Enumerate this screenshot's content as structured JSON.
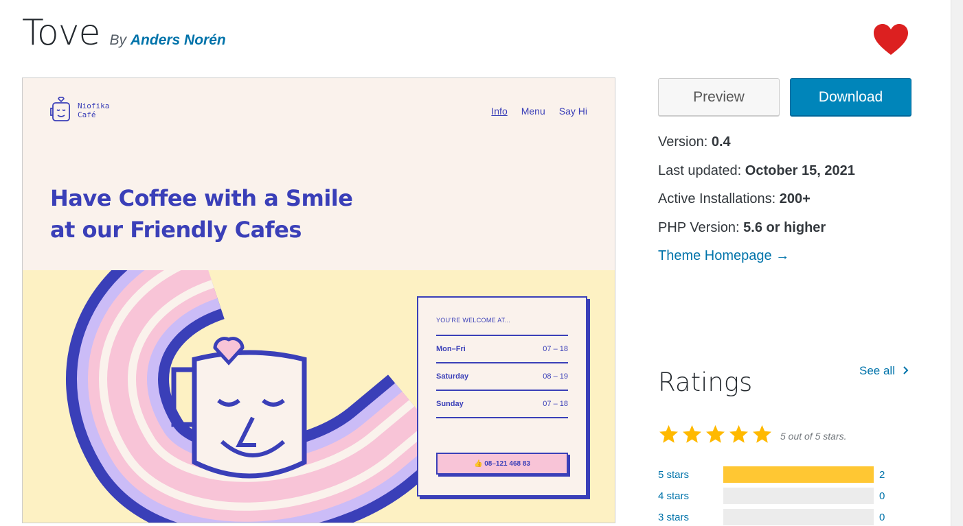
{
  "theme": {
    "title": "Tove",
    "by_prefix": "By",
    "author": "Anders Norén"
  },
  "screenshot": {
    "logo_text": "Niofika\nCafé",
    "nav": [
      "Info",
      "Menu",
      "Say Hi"
    ],
    "headline_line1": "Have Coffee with a Smile",
    "headline_line2": "at our Friendly Cafes",
    "card_title": "YOU'RE WELCOME AT...",
    "hours": [
      {
        "day": "Mon–Fri",
        "time": "07 – 18"
      },
      {
        "day": "Saturday",
        "time": "08 – 19"
      },
      {
        "day": "Sunday",
        "time": "07 – 18"
      }
    ],
    "phone": "👍 08–121 468 83"
  },
  "actions": {
    "preview_label": "Preview",
    "download_label": "Download"
  },
  "meta": {
    "version_label": "Version:",
    "version_value": "0.4",
    "updated_label": "Last updated:",
    "updated_value": "October 15, 2021",
    "installs_label": "Active Installations:",
    "installs_value": "200+",
    "php_label": "PHP Version:",
    "php_value": "5.6 or higher",
    "homepage_link": "Theme Homepage →"
  },
  "ratings": {
    "title": "Ratings",
    "see_all": "See all",
    "stars_caption": "5 out of 5 stars.",
    "stars_value": 5,
    "bars": [
      {
        "label": "5 stars",
        "count": "2",
        "fraction": 1.0
      },
      {
        "label": "4 stars",
        "count": "0",
        "fraction": 0
      },
      {
        "label": "3 stars",
        "count": "0",
        "fraction": 0
      }
    ]
  },
  "colors": {
    "link": "#0073aa",
    "download_bg": "#0085ba",
    "star": "#ffb900",
    "bar_fill": "#ffc733",
    "heart": "#dc2020",
    "cafe_blue": "#3a3fb8"
  },
  "icons": [
    "heart-icon",
    "star-icon",
    "chevron-right-icon",
    "arrow-right-icon"
  ]
}
